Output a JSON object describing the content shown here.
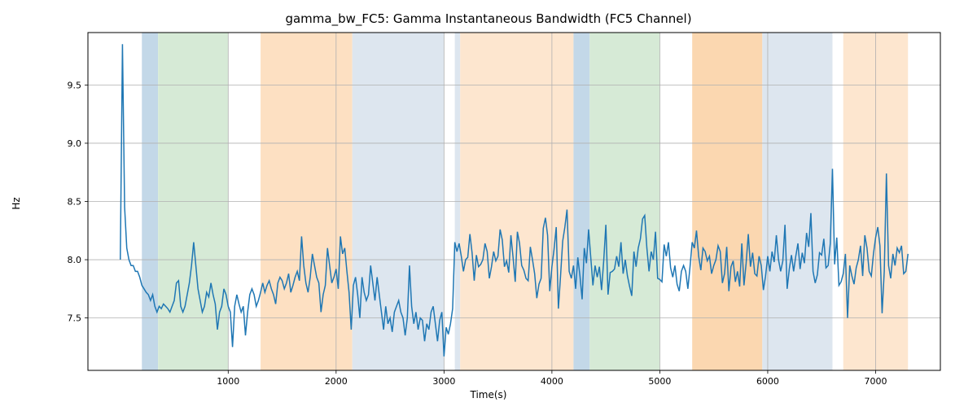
{
  "chart_data": {
    "type": "line",
    "title": "gamma_bw_FC5: Gamma Instantaneous Bandwidth (FC5 Channel)",
    "xlabel": "Time(s)",
    "ylabel": "Hz",
    "xlim": [
      -300,
      7600
    ],
    "ylim": [
      7.05,
      9.95
    ],
    "xticks": [
      1000,
      2000,
      3000,
      4000,
      5000,
      6000,
      7000
    ],
    "yticks": [
      7.5,
      8.0,
      8.5,
      9.0,
      9.5
    ],
    "grid": true,
    "background_spans": [
      {
        "x0": 200,
        "x1": 350,
        "color": "#c3d8e8",
        "label": "blue"
      },
      {
        "x0": 350,
        "x1": 1000,
        "color": "#d6ead6",
        "label": "green"
      },
      {
        "x0": 1300,
        "x1": 2150,
        "color": "#fde0c2",
        "label": "orange"
      },
      {
        "x0": 2150,
        "x1": 3000,
        "color": "#dde6ef",
        "label": "lightblue"
      },
      {
        "x0": 3100,
        "x1": 3150,
        "color": "#dde6ef",
        "label": "lightblue"
      },
      {
        "x0": 3150,
        "x1": 4200,
        "color": "#fde6cf",
        "label": "orange-pale"
      },
      {
        "x0": 4200,
        "x1": 4350,
        "color": "#c3d8e8",
        "label": "blue"
      },
      {
        "x0": 4350,
        "x1": 5000,
        "color": "#d6ead6",
        "label": "green"
      },
      {
        "x0": 5300,
        "x1": 5950,
        "color": "#fbd7b0",
        "label": "orange"
      },
      {
        "x0": 5950,
        "x1": 6600,
        "color": "#dde6ef",
        "label": "lightblue"
      },
      {
        "x0": 6700,
        "x1": 7300,
        "color": "#fde6cf",
        "label": "orange-pale"
      }
    ],
    "series": [
      {
        "name": "gamma_bw_FC5",
        "x_step": 20,
        "x_start": 0,
        "values": [
          8.0,
          9.85,
          8.45,
          8.1,
          8.0,
          7.95,
          7.95,
          7.9,
          7.9,
          7.85,
          7.78,
          7.75,
          7.72,
          7.7,
          7.65,
          7.7,
          7.6,
          7.55,
          7.6,
          7.58,
          7.62,
          7.6,
          7.58,
          7.55,
          7.6,
          7.65,
          7.8,
          7.82,
          7.6,
          7.55,
          7.6,
          7.7,
          7.8,
          7.95,
          8.15,
          7.95,
          7.75,
          7.65,
          7.55,
          7.6,
          7.72,
          7.68,
          7.8,
          7.7,
          7.62,
          7.4,
          7.55,
          7.6,
          7.75,
          7.7,
          7.6,
          7.55,
          7.25,
          7.6,
          7.7,
          7.62,
          7.55,
          7.6,
          7.35,
          7.55,
          7.7,
          7.75,
          7.7,
          7.6,
          7.65,
          7.72,
          7.8,
          7.72,
          7.78,
          7.82,
          7.75,
          7.7,
          7.62,
          7.8,
          7.85,
          7.82,
          7.75,
          7.8,
          7.88,
          7.72,
          7.78,
          7.85,
          7.9,
          7.82,
          8.2,
          7.95,
          7.8,
          7.72,
          7.85,
          8.05,
          7.95,
          7.85,
          7.8,
          7.55,
          7.7,
          7.78,
          8.1,
          7.95,
          7.8,
          7.85,
          7.92,
          7.75,
          8.2,
          8.05,
          8.1,
          7.9,
          7.72,
          7.4,
          7.78,
          7.85,
          7.7,
          7.5,
          7.85,
          7.72,
          7.65,
          7.7,
          7.95,
          7.8,
          7.65,
          7.85,
          7.7,
          7.55,
          7.4,
          7.6,
          7.45,
          7.5,
          7.38,
          7.55,
          7.6,
          7.65,
          7.55,
          7.5,
          7.35,
          7.5,
          7.95,
          7.6,
          7.45,
          7.55,
          7.4,
          7.5,
          7.48,
          7.3,
          7.45,
          7.4,
          7.55,
          7.6,
          7.45,
          7.3,
          7.48,
          7.55,
          7.17,
          7.42,
          7.36,
          7.45,
          7.58,
          8.15,
          8.07,
          8.14,
          8.03,
          7.9,
          8.0,
          8.02,
          8.22,
          8.06,
          7.82,
          8.04,
          7.94,
          7.96,
          8.0,
          8.14,
          8.07,
          7.84,
          7.94,
          8.07,
          7.99,
          8.03,
          8.26,
          8.17,
          7.94,
          7.99,
          7.89,
          8.21,
          8.02,
          7.81,
          8.24,
          8.14,
          7.95,
          7.91,
          7.84,
          7.82,
          8.11,
          8.0,
          7.88,
          7.67,
          7.79,
          7.84,
          8.27,
          8.36,
          8.21,
          7.73,
          7.94,
          8.09,
          8.28,
          7.58,
          7.86,
          8.16,
          8.28,
          8.43,
          7.9,
          7.84,
          7.95,
          7.75,
          8.02,
          7.86,
          7.66,
          8.1,
          7.97,
          8.26,
          8.02,
          7.78,
          7.95,
          7.85,
          7.94,
          7.74,
          7.99,
          8.3,
          7.7,
          7.89,
          7.9,
          7.92,
          8.03,
          7.94,
          8.15,
          7.88,
          8.0,
          7.86,
          7.77,
          7.69,
          8.07,
          7.94,
          8.1,
          8.18,
          8.35,
          8.38,
          8.1,
          7.9,
          8.07,
          8.0,
          8.24,
          7.84,
          7.83,
          7.81,
          8.13,
          8.03,
          8.15,
          7.93,
          7.85,
          7.95,
          7.79,
          7.73,
          7.9,
          7.95,
          7.9,
          7.75,
          7.94,
          8.15,
          8.1,
          8.25,
          8.03,
          7.91,
          8.1,
          8.07,
          7.99,
          8.03,
          7.88,
          7.95,
          8.0,
          8.12,
          8.07,
          7.8,
          7.88,
          8.11,
          7.73,
          7.94,
          7.99,
          7.81,
          7.9,
          7.77,
          8.14,
          7.78,
          7.97,
          8.22,
          7.94,
          8.06,
          7.88,
          7.86,
          8.03,
          7.95,
          7.74,
          7.86,
          8.03,
          7.9,
          8.07,
          7.98,
          8.21,
          8.0,
          7.9,
          7.99,
          8.3,
          7.75,
          7.92,
          8.04,
          7.9,
          8.03,
          8.14,
          7.92,
          8.06,
          7.97,
          8.23,
          8.11,
          8.4,
          7.9,
          7.8,
          7.87,
          8.06,
          8.04,
          8.18,
          7.93,
          7.95,
          8.14,
          8.78,
          7.96,
          8.19,
          7.78,
          7.81,
          7.88,
          8.05,
          7.5,
          7.95,
          7.86,
          7.79,
          7.93,
          8.0,
          8.12,
          7.86,
          8.21,
          8.1,
          7.9,
          7.86,
          8.05,
          8.19,
          8.28,
          8.12,
          7.54,
          7.9,
          8.74,
          7.95,
          7.84,
          8.05,
          7.95,
          8.1,
          8.06,
          8.12,
          7.88,
          7.9,
          8.05
        ]
      }
    ]
  }
}
